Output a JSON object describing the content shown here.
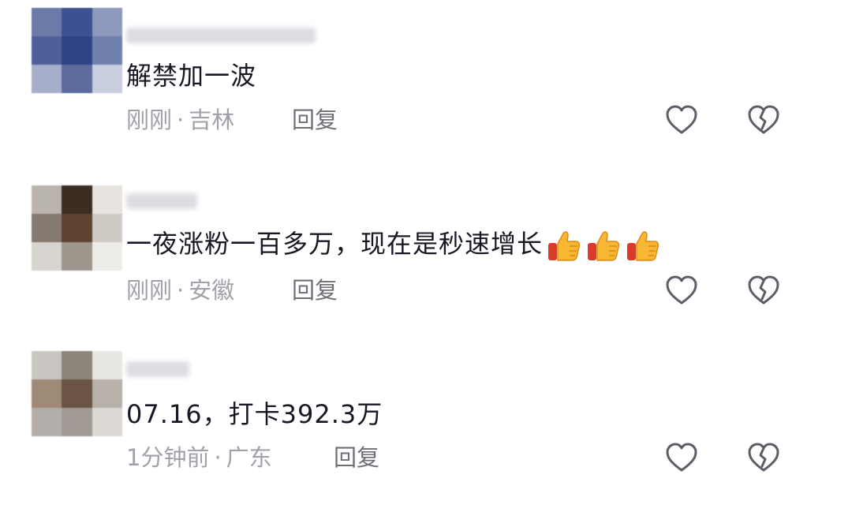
{
  "comments": [
    {
      "text": "解禁加一波",
      "time": "刚刚",
      "sep": "·",
      "location": "吉林",
      "reply_label": "回复",
      "avatar_colors": [
        "#6c7aa8",
        "#3c5190",
        "#8d98bd",
        "#4f5f97",
        "#2e4383",
        "#7280ae",
        "#a6aecb",
        "#5d6b9e",
        "#c8cde0"
      ]
    },
    {
      "text": "一夜涨粉一百多万，现在是秒速增长",
      "emojis": [
        "thumbs-up-icon",
        "thumbs-up-icon",
        "thumbs-up-icon"
      ],
      "time": "刚刚",
      "sep": "·",
      "location": "安徽",
      "reply_label": "回复",
      "avatar_colors": [
        "#b9b4ae",
        "#3b2d22",
        "#e7e4e0",
        "#857a70",
        "#5d4330",
        "#cfcac4",
        "#d8d4cf",
        "#9f968d",
        "#efedea"
      ]
    },
    {
      "text": "07.16，打卡392.3万",
      "time": "1分钟前",
      "sep": "·",
      "location": "广东",
      "reply_label": "回复",
      "avatar_colors": [
        "#c9c5c1",
        "#8d857c",
        "#e9e7e4",
        "#9e8a76",
        "#6b5443",
        "#b7b1aa",
        "#b2ada8",
        "#a39b93",
        "#dcd9d5"
      ]
    }
  ],
  "colors": {
    "text": "#161823",
    "meta": "#a0a2aa",
    "reply": "#6d6e76",
    "icon": "#5c5d66"
  }
}
